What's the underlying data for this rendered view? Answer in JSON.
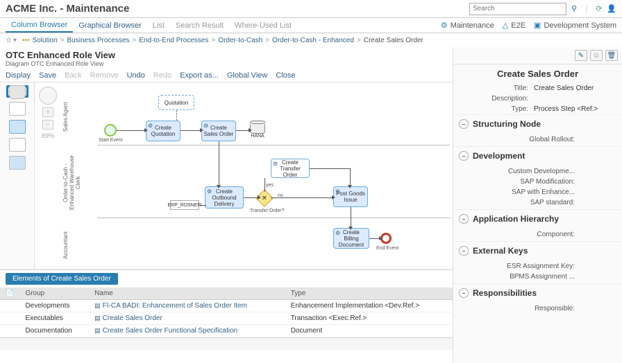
{
  "header": {
    "app_title": "ACME Inc. - Maintenance",
    "search_placeholder": "Search"
  },
  "tabs": {
    "column_browser": "Column Browser",
    "graphical_browser": "Graphical Browser",
    "list": "List",
    "search_result": "Search Result",
    "where_used": "Where-Used List"
  },
  "right_links": {
    "maintenance": "Maintenance",
    "e2e": "E2E",
    "dev_system": "Development System"
  },
  "breadcrumb": {
    "solution": "Solution",
    "bp": "Business Processes",
    "e2e": "End-to-End Processes",
    "otc": "Order-to-Cash",
    "otc_enh": "Order-to-Cash - Enhanced",
    "current": "Create Sales Order"
  },
  "view": {
    "title": "OTC Enhanced Role View",
    "subtitle": "Diagram OTC Enhanced Role View"
  },
  "diag_toolbar": {
    "display": "Display",
    "save": "Save",
    "back": "Back",
    "remove": "Remove",
    "undo": "Undo",
    "redo": "Redo",
    "export_as": "Export as...",
    "global_view": "Global View",
    "close": "Close"
  },
  "zoom": "89%",
  "lanes": {
    "sales": "Sales Agent",
    "warehouse": "Order-to-Cash - Enhanced\nWarehouse Clerk",
    "accountant": "Accountant"
  },
  "nodes": {
    "start": "Start Event",
    "quotation": "Quotation",
    "create_quotation": "Create Quotation",
    "create_sales_order": "Create Sales Order",
    "hana": "HANA",
    "create_transfer_order": "Create Transfer Order",
    "create_outbound": "Create Outbound Delivery",
    "erp": "ERP_RDSNEFI",
    "transfer_q": "Transfer Order?",
    "yes": "yes",
    "no": "no",
    "post_goods": "Post Goods Issue",
    "create_billing": "Create Billing Document",
    "end": "End Event"
  },
  "table": {
    "tab_label": "Elements of Create Sales Order",
    "headers": {
      "group": "Group",
      "name": "Name",
      "type": "Type"
    },
    "rows": [
      {
        "group": "Developments",
        "name": "FI-CA BADI: Enhancement of Sales Order Item",
        "type": "Enhancement Implementation <Dev.Ref.>"
      },
      {
        "group": "Executables",
        "name": "Create Sales Order",
        "type": "Transaction <Exec.Ref.>"
      },
      {
        "group": "Documentation",
        "name": "Create Sales Order Functional Specification",
        "type": "Document"
      }
    ]
  },
  "right_panel": {
    "title": "Create Sales Order",
    "props": {
      "title_k": "Title:",
      "title_v": "Create Sales Order",
      "desc_k": "Description:",
      "desc_v": "",
      "type_k": "Type:",
      "type_v": "Process Step <Ref.>"
    },
    "sections": {
      "structuring": "Structuring Node",
      "structuring_body": "Global Rollout:",
      "development": "Development",
      "dev_body": {
        "a": "Custom Developme...",
        "b": "SAP Modification:",
        "c": "SAP with Enhance...",
        "d": "SAP standard:"
      },
      "app_hier": "Application Hierarchy",
      "app_body": "Component:",
      "ext_keys": "External Keys",
      "ext_body": {
        "a": "ESR Assignment Key:",
        "b": "BPMS Assignment ..."
      },
      "resp": "Responsibilities",
      "resp_body": "Responsible:"
    }
  }
}
